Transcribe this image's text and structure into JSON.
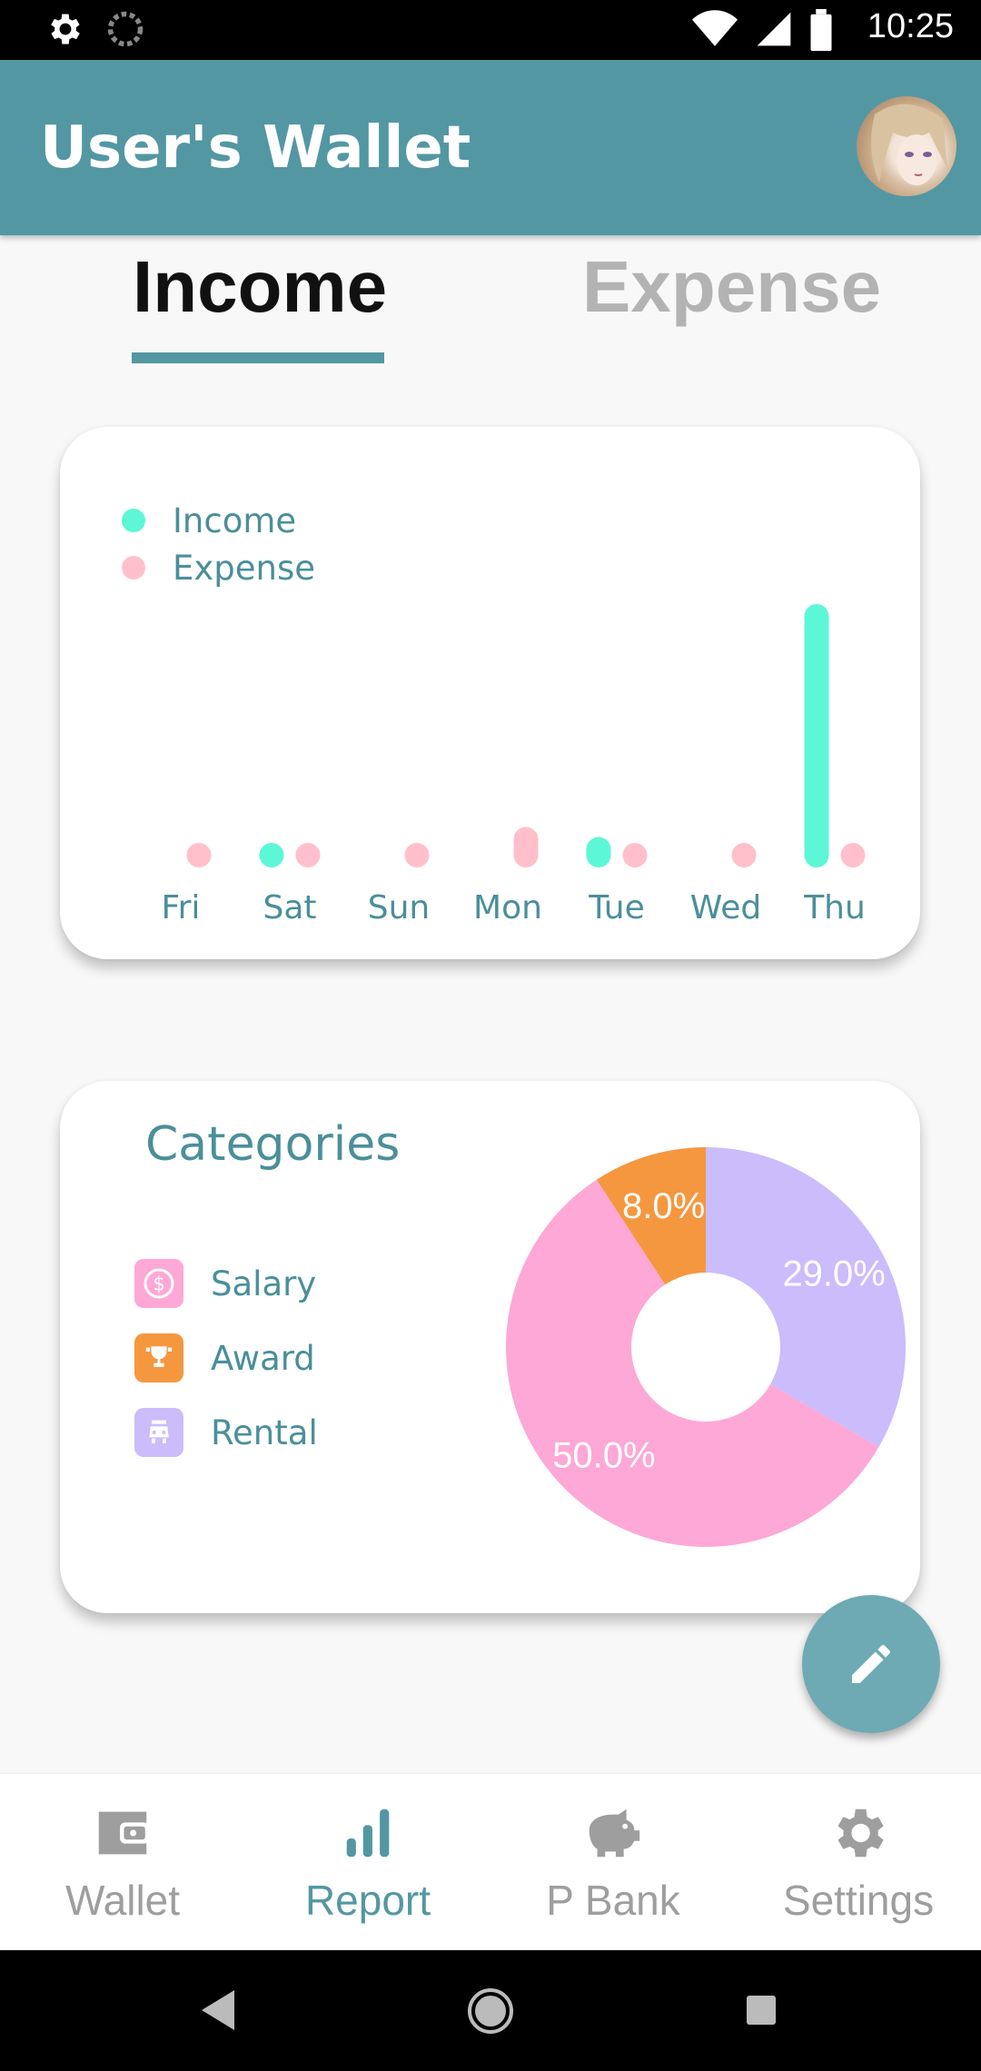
{
  "status_bar": {
    "time": "10:25",
    "icons": [
      "settings-icon",
      "sync-icon",
      "wifi-icon",
      "signal-icon",
      "battery-icon"
    ]
  },
  "app_bar": {
    "title": "User's Wallet",
    "avatar": "profile-avatar"
  },
  "tabs": [
    {
      "label": "Income",
      "selected": true
    },
    {
      "label": "Expense",
      "selected": false
    }
  ],
  "colors": {
    "primary": "#5397a3",
    "income": "#5cf7d6",
    "expense": "#ffc0cb",
    "salary": "#fda8d6",
    "award": "#f5973f",
    "rental": "#cbbcfb"
  },
  "chart_data": [
    {
      "type": "bar",
      "categories": [
        "Fri",
        "Sat",
        "Sun",
        "Mon",
        "Tue",
        "Wed",
        "Thu"
      ],
      "series": [
        {
          "name": "Income",
          "values": [
            0,
            1,
            0,
            0,
            3,
            0,
            26
          ]
        },
        {
          "name": "Expense",
          "values": [
            1,
            1,
            1,
            4,
            1,
            1,
            1
          ]
        }
      ],
      "legend": {
        "items": [
          "Income",
          "Expense"
        ],
        "placement": "top-left"
      },
      "grid": false
    },
    {
      "type": "pie",
      "title": "Categories",
      "labels": [
        "Rental",
        "Salary",
        "Award"
      ],
      "values": [
        29.0,
        50.0,
        8.0
      ],
      "value_labels": [
        "29.0%",
        "50.0%",
        "8.0%"
      ],
      "donut": true
    }
  ],
  "categories_card": {
    "title": "Categories",
    "items": [
      {
        "label": "Salary",
        "icon": "dollar-icon"
      },
      {
        "label": "Award",
        "icon": "trophy-icon"
      },
      {
        "label": "Rental",
        "icon": "car-icon"
      }
    ]
  },
  "fab": {
    "icon": "edit-icon"
  },
  "bottom_nav": [
    {
      "label": "Wallet",
      "icon": "wallet-icon",
      "active": false
    },
    {
      "label": "Report",
      "icon": "chart-icon",
      "active": true
    },
    {
      "label": "P Bank",
      "icon": "piggy-bank-icon",
      "active": false
    },
    {
      "label": "Settings",
      "icon": "gear-icon",
      "active": false
    }
  ]
}
